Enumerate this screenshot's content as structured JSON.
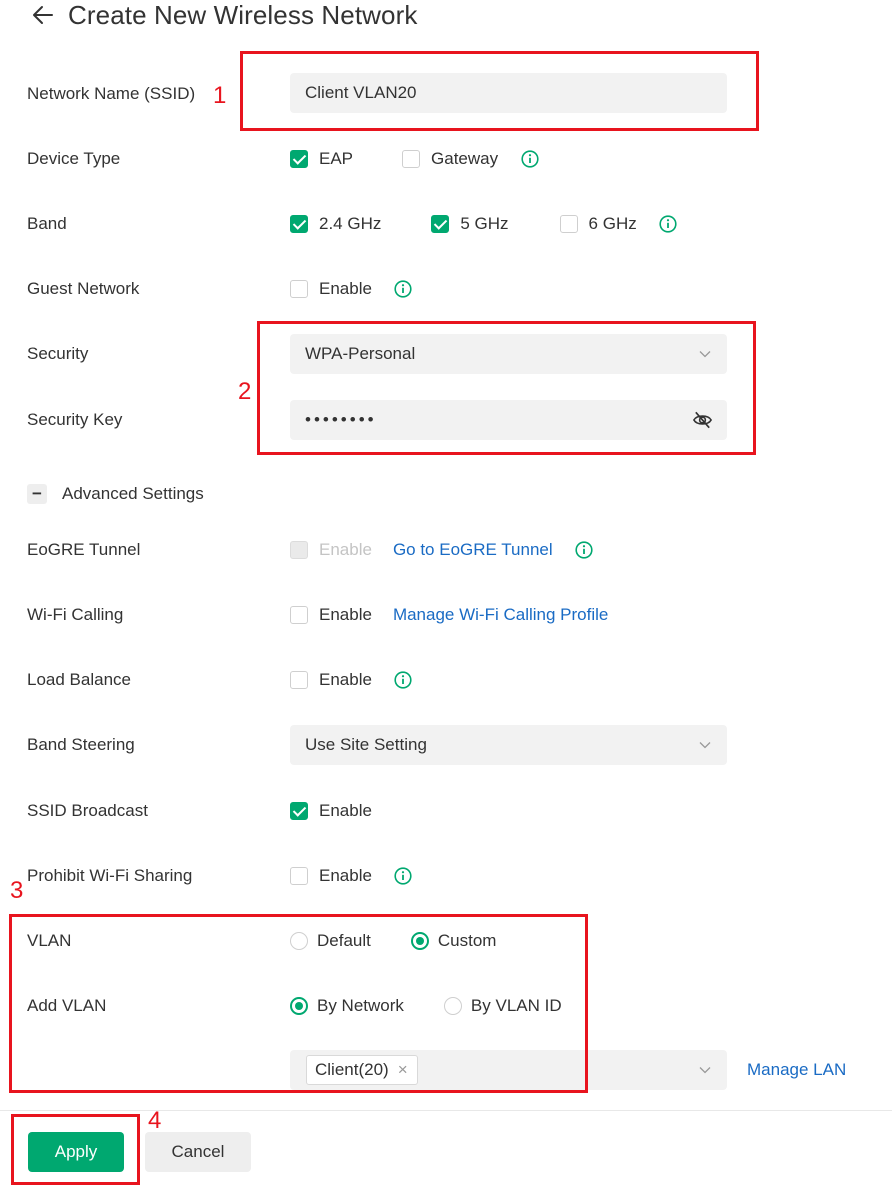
{
  "header": {
    "title": "Create New Wireless Network"
  },
  "ssid": {
    "label": "Network Name (SSID)",
    "value": "Client VLAN20"
  },
  "device_type": {
    "label": "Device Type",
    "options": [
      {
        "label": "EAP",
        "checked": true
      },
      {
        "label": "Gateway",
        "checked": false
      }
    ]
  },
  "band": {
    "label": "Band",
    "options": [
      {
        "label": "2.4 GHz",
        "checked": true
      },
      {
        "label": "5 GHz",
        "checked": true
      },
      {
        "label": "6 GHz",
        "checked": false
      }
    ]
  },
  "guest_network": {
    "label": "Guest Network",
    "option": "Enable",
    "checked": false
  },
  "security": {
    "label": "Security",
    "value": "WPA-Personal"
  },
  "security_key": {
    "label": "Security Key",
    "value": "••••••••"
  },
  "advanced": {
    "label": "Advanced Settings",
    "toggle": "−"
  },
  "eogre": {
    "label": "EoGRE Tunnel",
    "option": "Enable",
    "link": "Go to EoGRE Tunnel",
    "checked": false,
    "disabled": true
  },
  "wifi_calling": {
    "label": "Wi-Fi Calling",
    "option": "Enable",
    "link": "Manage Wi-Fi Calling Profile",
    "checked": false
  },
  "load_balance": {
    "label": "Load Balance",
    "option": "Enable",
    "checked": false
  },
  "band_steering": {
    "label": "Band Steering",
    "value": "Use Site Setting"
  },
  "ssid_broadcast": {
    "label": "SSID Broadcast",
    "option": "Enable",
    "checked": true
  },
  "prohibit_sharing": {
    "label": "Prohibit Wi-Fi Sharing",
    "option": "Enable",
    "checked": false
  },
  "vlan": {
    "label": "VLAN",
    "options": [
      {
        "label": "Default",
        "selected": false
      },
      {
        "label": "Custom",
        "selected": true
      }
    ]
  },
  "add_vlan": {
    "label": "Add VLAN",
    "options": [
      {
        "label": "By Network",
        "selected": true
      },
      {
        "label": "By VLAN ID",
        "selected": false
      }
    ]
  },
  "network_select": {
    "tag": "Client(20)",
    "tag_close": "×",
    "link": "Manage LAN"
  },
  "footer": {
    "apply": "Apply",
    "cancel": "Cancel"
  },
  "annotations": [
    "1",
    "2",
    "3",
    "4"
  ],
  "colors": {
    "accent": "#00a870",
    "link": "#1a6bc4",
    "annotation_red": "#e8141e",
    "field_bg": "#f2f2f2",
    "cancel_bg": "#eeeeee"
  },
  "icons": [
    "back-arrow-icon",
    "info-icon",
    "chevron-down-icon",
    "eye-off-icon",
    "checkbox-checked-icon",
    "minus-icon",
    "close-icon"
  ]
}
